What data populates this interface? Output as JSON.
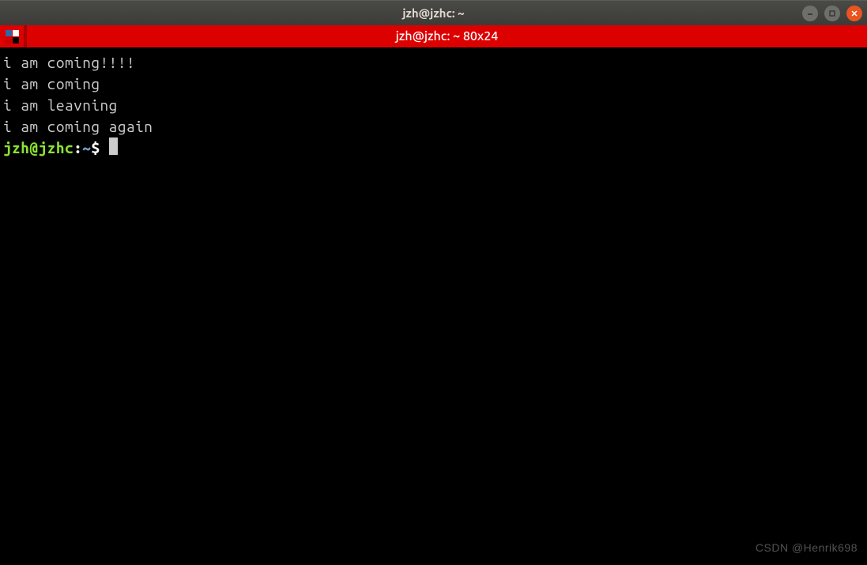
{
  "window": {
    "title": "jzh@jzhc: ~"
  },
  "tab": {
    "label": "jzh@jzhc: ~ 80x24"
  },
  "terminal": {
    "lines": [
      "i am coming!!!!",
      "i am coming",
      "i am leavning",
      "i am coming again"
    ],
    "prompt": {
      "user_host": "jzh@jzhc",
      "colon": ":",
      "path": "~",
      "symbol": "$ "
    }
  },
  "watermark": "CSDN @Henrik698"
}
